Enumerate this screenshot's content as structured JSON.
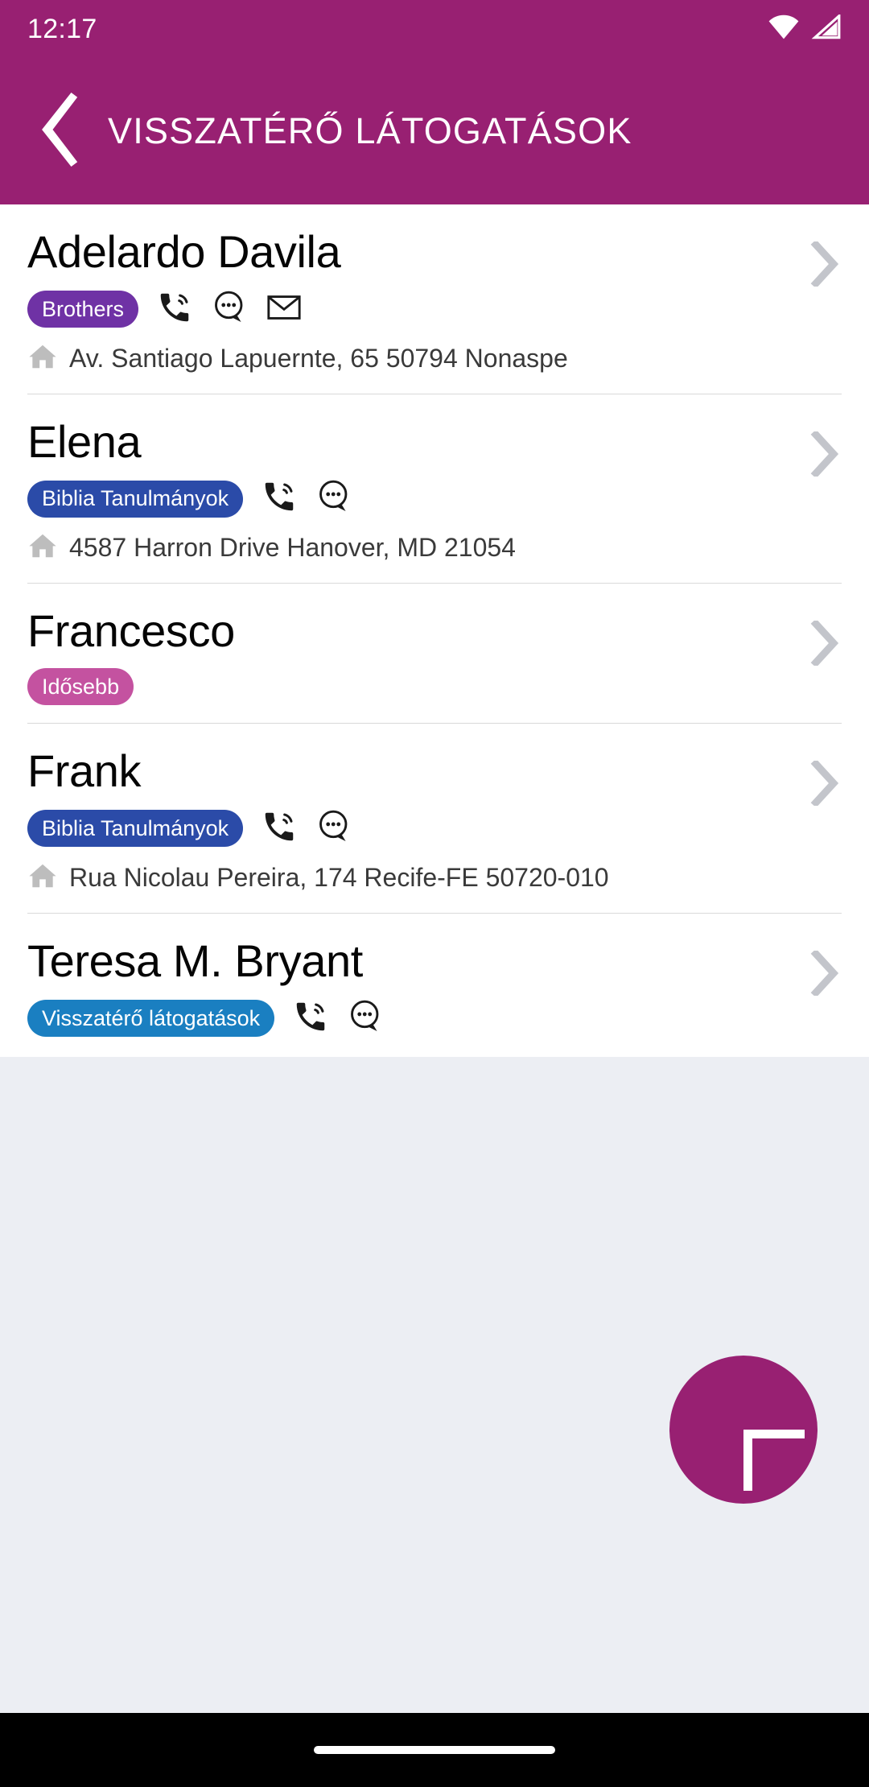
{
  "status_bar": {
    "time": "12:17",
    "wifi_icon": "wifi-icon",
    "signal_icon": "cell-signal-icon"
  },
  "app_bar": {
    "back_icon": "back-chevron-icon",
    "title": "VISSZATÉRŐ LÁTOGATÁSOK",
    "background_color": "#982072"
  },
  "colors": {
    "brand": "#982072",
    "badge_purple": "#6f32a5",
    "badge_blue": "#2b4ba8",
    "badge_light_blue": "#1a7fc1",
    "badge_pink": "#c452a0",
    "page_background": "#eceef3",
    "divider": "#d9d9d9",
    "chevron": "#c3c5cb"
  },
  "contacts": [
    {
      "name": "Adelardo Davila",
      "badge": {
        "label": "Brothers",
        "color": "#6f32a5"
      },
      "actions": [
        "phone-icon",
        "chat-icon",
        "email-icon"
      ],
      "address": "Av. Santiago Lapuernte, 65 50794 Nonaspe",
      "home_icon": "home-icon",
      "chevron_icon": "chevron-right-icon"
    },
    {
      "name": "Elena",
      "badge": {
        "label": "Biblia Tanulmányok",
        "color": "#2b4ba8"
      },
      "actions": [
        "phone-icon",
        "chat-icon"
      ],
      "address": "4587 Harron Drive Hanover, MD 21054",
      "home_icon": "home-icon",
      "chevron_icon": "chevron-right-icon"
    },
    {
      "name": "Francesco",
      "badge": {
        "label": "Idősebb",
        "color": "#c452a0"
      },
      "actions": [],
      "address": "",
      "home_icon": "",
      "chevron_icon": "chevron-right-icon"
    },
    {
      "name": "Frank",
      "badge": {
        "label": "Biblia Tanulmányok",
        "color": "#2b4ba8"
      },
      "actions": [
        "phone-icon",
        "chat-icon"
      ],
      "address": "Rua Nicolau Pereira, 174 Recife-FE 50720-010",
      "home_icon": "home-icon",
      "chevron_icon": "chevron-right-icon"
    },
    {
      "name": "Teresa M. Bryant",
      "badge": {
        "label": "Visszatérő látogatások",
        "color": "#1a7fc1"
      },
      "actions": [
        "phone-icon",
        "chat-icon"
      ],
      "address": "",
      "home_icon": "",
      "chevron_icon": "chevron-right-icon"
    }
  ],
  "fab": {
    "icon": "plus-icon",
    "color": "#982072"
  },
  "navigation_bar": {
    "home_pill": "home-pill-indicator"
  }
}
